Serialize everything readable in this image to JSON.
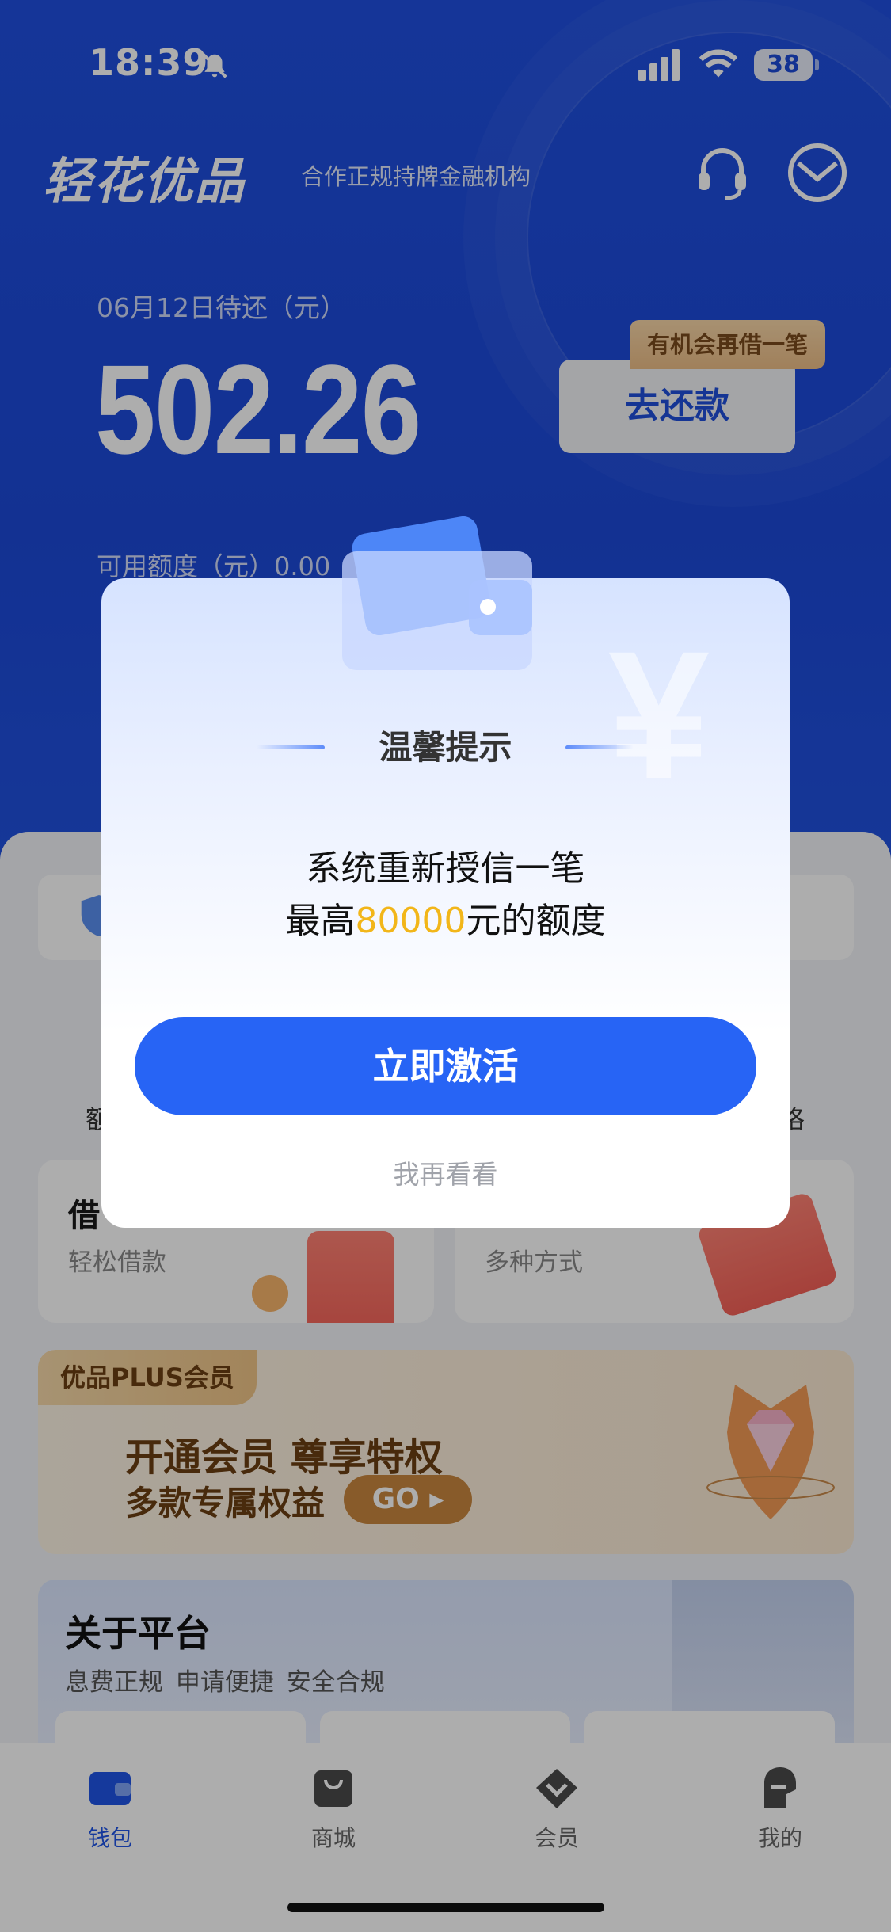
{
  "status": {
    "time": "18:39",
    "battery": "38"
  },
  "header": {
    "brand": "轻花优品",
    "subtitle": "合作正规持牌金融机构"
  },
  "repayment": {
    "due_label": "06月12日待还（元）",
    "amount": "502.26",
    "button": "去还款",
    "badge": "有机会再借一笔",
    "available_label": "可用额度（元）0.00"
  },
  "background": {
    "left_edge_text": "额",
    "right_edge_text": "咯",
    "loan_card": {
      "title": "借",
      "subtitle": "轻松借款"
    },
    "repay_card": {
      "subtitle": "多种方式"
    },
    "plus": {
      "tag": "优品PLUS会员",
      "headline": "开通会员 尊享特权",
      "subline": "多款专属权益",
      "go": "GO ▸"
    },
    "about": {
      "title": "关于平台",
      "subtitle": "息费正规 申请便捷 安全合规"
    }
  },
  "modal": {
    "title": "温馨提示",
    "line1": "系统重新授信一笔",
    "line2_prefix": "最高",
    "line2_amount": "80000",
    "line2_suffix": "元的额度",
    "primary_button": "立即激活",
    "secondary_button": "我再看看",
    "yen_symbol": "¥"
  },
  "tabs": [
    {
      "label": "钱包",
      "icon": "wallet-icon",
      "active": true
    },
    {
      "label": "商城",
      "icon": "shopping-bag-icon",
      "active": false
    },
    {
      "label": "会员",
      "icon": "diamond-icon",
      "active": false
    },
    {
      "label": "我的",
      "icon": "profile-icon",
      "active": false
    }
  ],
  "colors": {
    "primary_blue": "#2764f5",
    "header_blue": "#1f4fe0",
    "highlight_yellow": "#f2b619",
    "gold": "#c9873e"
  }
}
